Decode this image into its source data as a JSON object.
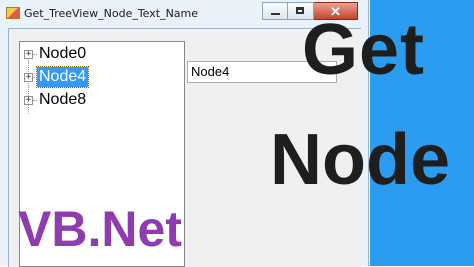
{
  "window": {
    "title": "Get_TreeView_Node_Text_Name",
    "caption_buttons": {
      "minimize": "minimize-icon",
      "maximize": "maximize-icon",
      "close": "✕"
    }
  },
  "treeview": {
    "nodes": [
      {
        "label": "Node0",
        "expander": "+",
        "selected": false
      },
      {
        "label": "Node4",
        "expander": "+",
        "selected": true
      },
      {
        "label": "Node8",
        "expander": "+",
        "selected": false
      }
    ]
  },
  "textbox": {
    "value": "Node4"
  },
  "overlay": {
    "line1": "Get",
    "line2": "Node",
    "line3": "VB.Net"
  },
  "colors": {
    "accent_blue": "#2b9cf0",
    "selection": "#3399ff",
    "vbnet_purple": "#8e3cb0"
  }
}
